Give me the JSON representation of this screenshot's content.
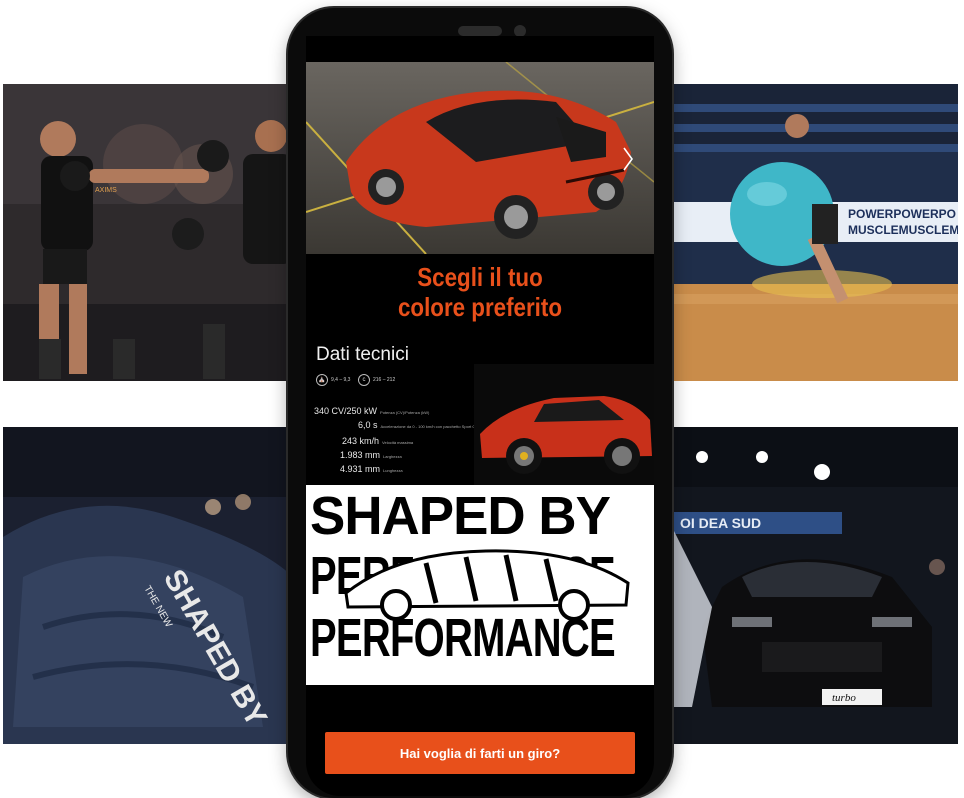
{
  "phone": {
    "headline_line1": "Scegli il tuo",
    "headline_line2": "colore preferito",
    "carousel": {
      "total_slides": 4,
      "active_slide": 1
    },
    "tech": {
      "title": "Dati tecnici",
      "fuel_chip": "9,4 – 9,3",
      "co2_chip": "216 – 212",
      "specs": [
        {
          "value": "340 CV/250 kW",
          "label": "Potenza (CV)/Potenza (kW)"
        },
        {
          "value": "6,0 s",
          "label": "Accelerazione da 0 - 100 km/h con pacchetto Sport Chrono"
        },
        {
          "value": "243 km/h",
          "label": "Velocità massima"
        },
        {
          "value": "1.983 mm",
          "label": "Larghezza"
        },
        {
          "value": "4.931 mm",
          "label": "Lunghezza"
        }
      ]
    },
    "poster": {
      "line1": "SHAPED BY",
      "line2": "PERFORMANCE",
      "line3": "PERFORMANCE"
    },
    "cta_label": "Hai voglia di farti un giro?"
  },
  "photos": {
    "top_left_shirt": "AXIMS",
    "top_right_banner": "POWERPOWERPO",
    "top_right_banner2": "MUSCLEMUSCLEM",
    "bottom_left_cover": "SHAPED BY",
    "bottom_left_cover_sub": "THE NEW",
    "bottom_right_banner": "OI DEA SUD",
    "bottom_right_plate": "turbo"
  },
  "colors": {
    "accent": "#e8501b",
    "car": "#c8381c",
    "screen": "#000000"
  }
}
